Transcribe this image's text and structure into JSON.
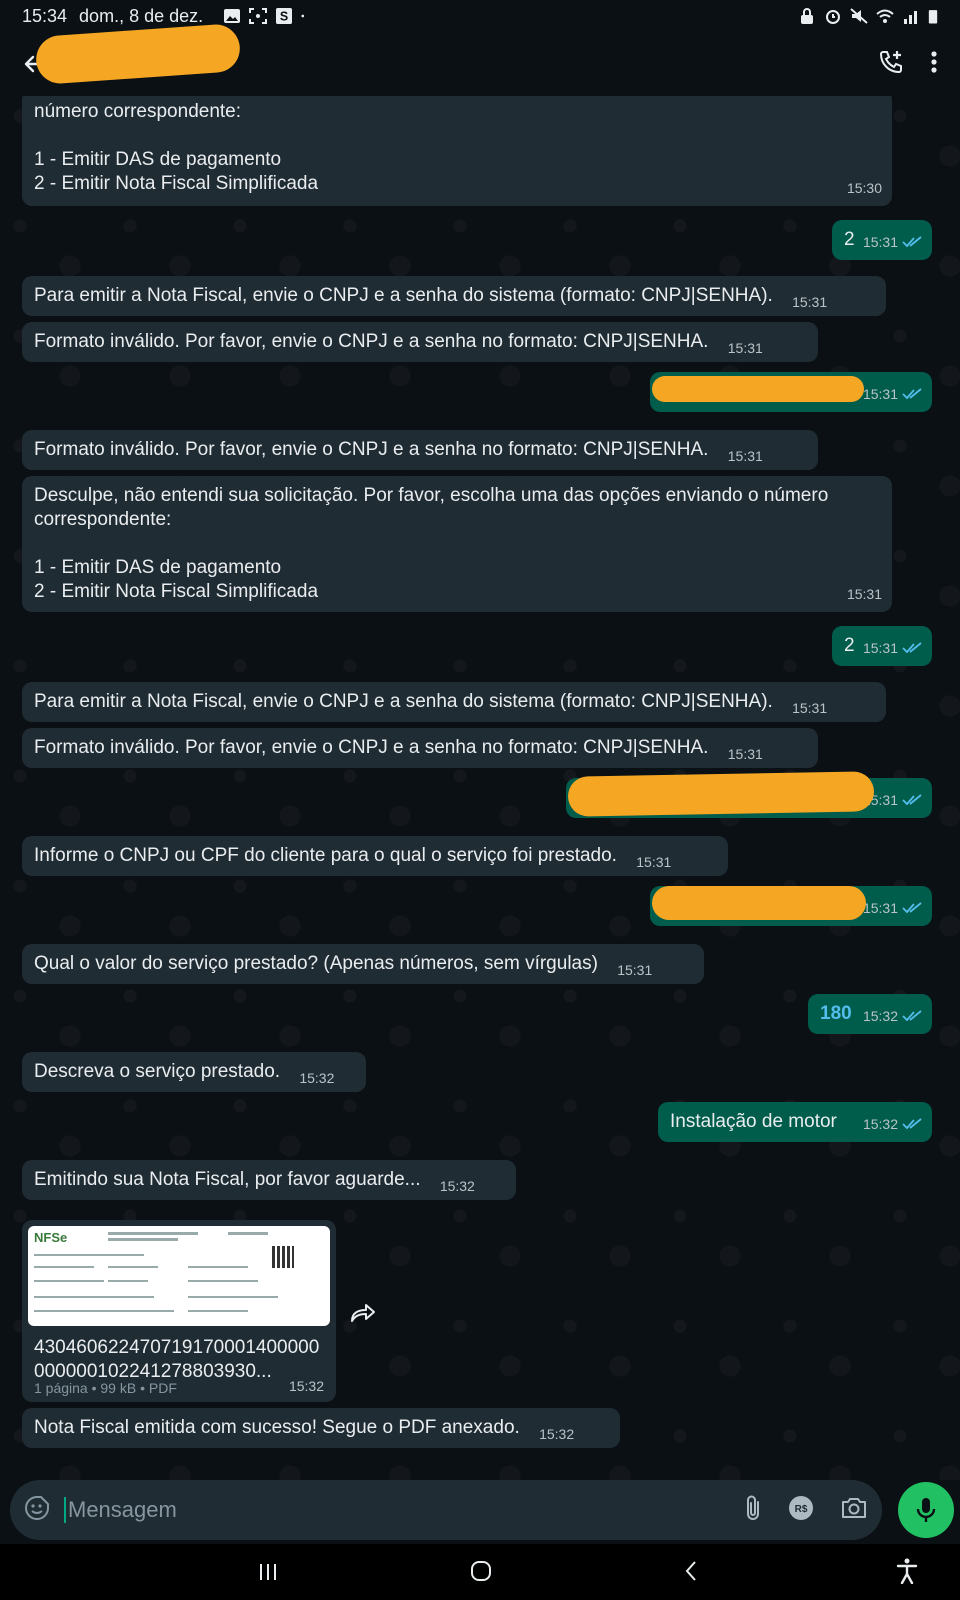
{
  "status_bar": {
    "time": "15:34",
    "date": "dom., 8 de dez."
  },
  "header": {
    "contact_name": ""
  },
  "messages": [
    {
      "text": "número correspondente:\n\n1 - Emitir DAS de pagamento\n2 - Emitir Nota Fiscal Simplificada",
      "time": "15:30"
    },
    {
      "text": "2",
      "time": "15:31"
    },
    {
      "text": "Para emitir a Nota Fiscal, envie o CNPJ e a senha do sistema (formato: CNPJ|SENHA).",
      "time": "15:31"
    },
    {
      "text": "Formato inválido. Por favor, envie o CNPJ e a senha no formato: CNPJ|SENHA.",
      "time": "15:31"
    },
    {
      "text": "",
      "time": "15:31"
    },
    {
      "text": "Formato inválido. Por favor, envie o CNPJ e a senha no formato: CNPJ|SENHA.",
      "time": "15:31"
    },
    {
      "text": "Desculpe, não entendi sua solicitação. Por favor, escolha uma das opções enviando o número correspondente:\n\n1 - Emitir DAS de pagamento\n2 - Emitir Nota Fiscal Simplificada",
      "time": "15:31"
    },
    {
      "text": "2",
      "time": "15:31"
    },
    {
      "text": "Para emitir a Nota Fiscal, envie o CNPJ e a senha do sistema (formato: CNPJ|SENHA).",
      "time": "15:31"
    },
    {
      "text": "Formato inválido. Por favor, envie o CNPJ e a senha no formato: CNPJ|SENHA.",
      "time": "15:31"
    },
    {
      "text": "",
      "time": "15:31"
    },
    {
      "text": "Informe o CNPJ ou CPF do cliente para o qual o serviço foi prestado.",
      "time": "15:31"
    },
    {
      "text": "",
      "time": "15:31"
    },
    {
      "text": "Qual o valor do serviço prestado? (Apenas números, sem vírgulas)",
      "time": "15:31"
    },
    {
      "text": "180",
      "time": "15:32"
    },
    {
      "text": "Descreva o serviço prestado.",
      "time": "15:32"
    },
    {
      "text": "Instalação de motor",
      "time": "15:32"
    },
    {
      "text": "Emitindo sua Nota Fiscal, por favor aguarde...",
      "time": "15:32"
    },
    {
      "text": "Nota Fiscal emitida com sucesso! Segue o PDF anexado.",
      "time": "15:32"
    }
  ],
  "attachment": {
    "name": "430460622470719170001400000000000102241278803930...",
    "info": "1 página • 99 kB • PDF",
    "time": "15:32",
    "thumb_brand": "NFSe"
  },
  "composer": {
    "placeholder": "Mensagem"
  },
  "colors": {
    "incoming": "#202c33",
    "outgoing": "#005c4b",
    "accent": "#00a884",
    "redaction": "#f5a623"
  }
}
